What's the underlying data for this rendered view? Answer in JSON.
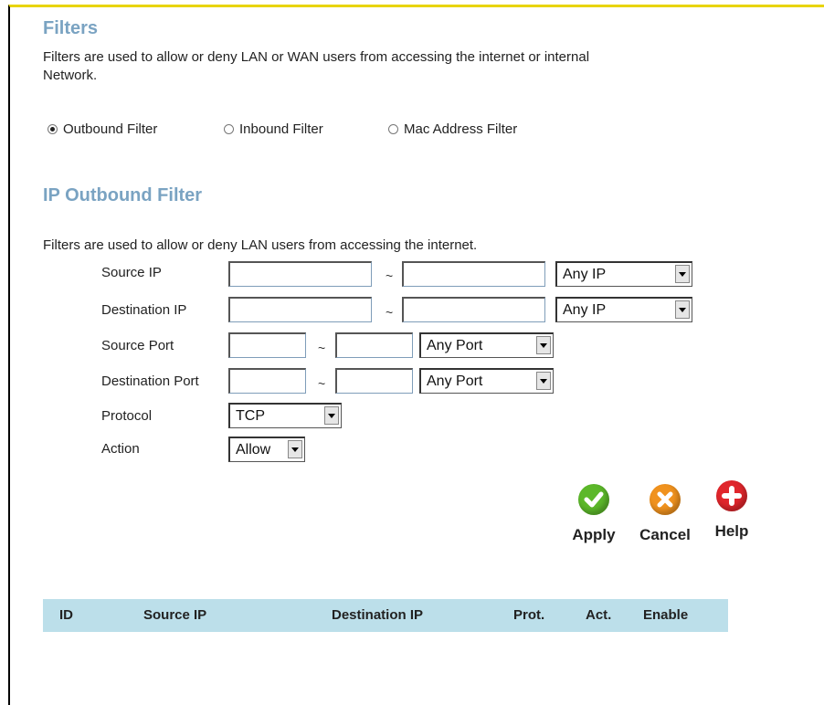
{
  "page": {
    "title": "Filters",
    "description": "Filters are used to allow or deny LAN or WAN users from accessing the internet or internal Network.",
    "description_line1": "Filters are used to allow or deny LAN or WAN users from accessing the internet or internal",
    "description_line2": "Network."
  },
  "filter_type": {
    "options": [
      {
        "label": "Outbound Filter",
        "selected": true
      },
      {
        "label": "Inbound Filter",
        "selected": false
      },
      {
        "label": "Mac Address Filter",
        "selected": false
      }
    ]
  },
  "section": {
    "title": "IP Outbound Filter",
    "description": "Filters are used to allow or deny LAN users from accessing the internet."
  },
  "form": {
    "source_ip": {
      "label": "Source IP",
      "start": "",
      "end": "",
      "separator": "~",
      "select": "Any IP"
    },
    "destination_ip": {
      "label": "Destination IP",
      "start": "",
      "end": "",
      "separator": "~",
      "select": "Any IP"
    },
    "source_port": {
      "label": "Source Port",
      "start": "",
      "end": "",
      "separator": "~",
      "select": "Any Port"
    },
    "destination_port": {
      "label": "Destination Port",
      "start": "",
      "end": "",
      "separator": "~",
      "select": "Any Port"
    },
    "protocol": {
      "label": "Protocol",
      "select": "TCP"
    },
    "action": {
      "label": "Action",
      "select": "Allow"
    }
  },
  "buttons": {
    "apply": {
      "label": "Apply",
      "icon": "check-icon",
      "color": "#5cb82a"
    },
    "cancel": {
      "label": "Cancel",
      "icon": "x-icon",
      "color": "#f0921e"
    },
    "help": {
      "label": "Help",
      "icon": "plus-icon",
      "color": "#e0262c"
    }
  },
  "table": {
    "columns": [
      "ID",
      "Source IP",
      "Destination IP",
      "Prot.",
      "Act.",
      "Enable"
    ],
    "header_color": "#bcdfea",
    "rows": []
  },
  "colors": {
    "title": "#7aa3c2",
    "top_border": "#e8d400"
  }
}
